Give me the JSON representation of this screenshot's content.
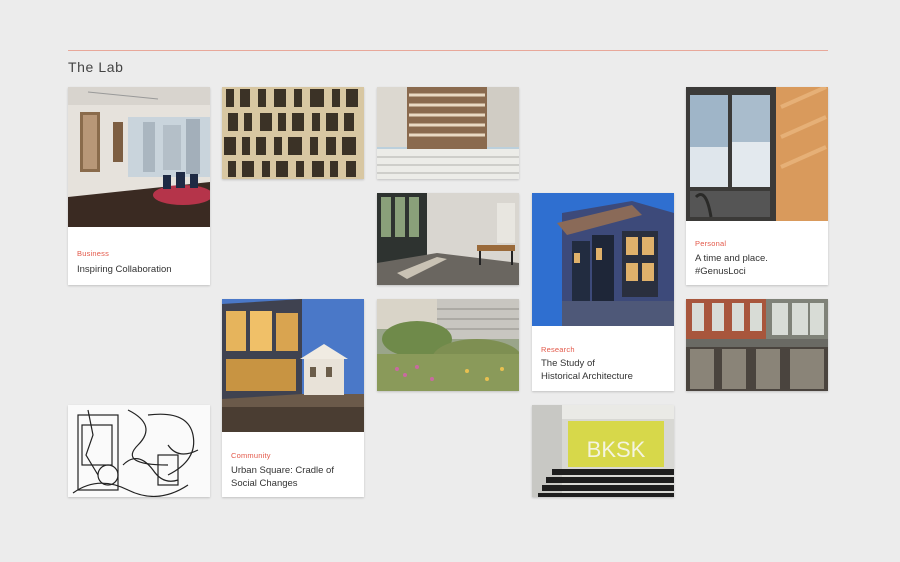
{
  "section_title": "The Lab",
  "cards": {
    "business": {
      "category": "Business",
      "caption": "Inspiring Collaboration",
      "image": "office-interior-photo"
    },
    "community": {
      "category": "Community",
      "caption_line1": "Urban Square: Cradle of",
      "caption_line2": "Social Changes",
      "image": "modern-house-photo"
    },
    "research": {
      "category": "Research",
      "caption_line1": "The Study of",
      "caption_line2": "Historical Architecture",
      "image": "blue-building-photo"
    },
    "personal": {
      "category": "Personal",
      "caption_line1": "A time and place.",
      "caption_line2": "#GenusLoci",
      "image": "window-view-photo"
    }
  },
  "photos": [
    "facade-grid-photo",
    "louvers-photo",
    "corridor-photo",
    "garden-photo",
    "brick-building-photo",
    "sketch-drawing",
    "auditorium-photo"
  ],
  "auditorium_sign": "BKSK",
  "colors": {
    "accent": "#e3594a",
    "rule": "#e8a89a",
    "background": "#ececec"
  }
}
